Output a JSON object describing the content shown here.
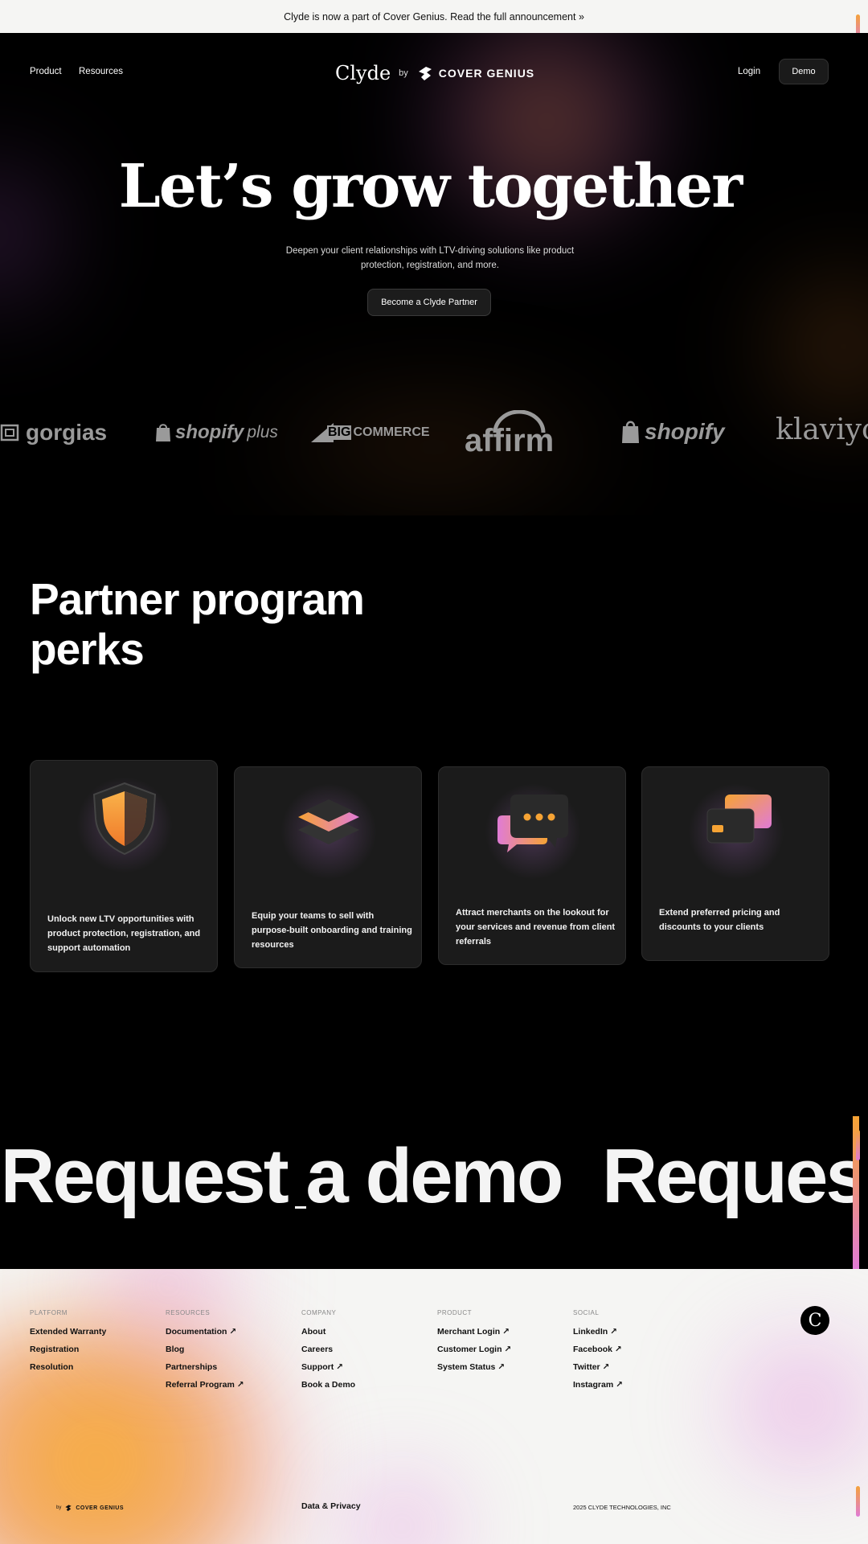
{
  "announcement": {
    "text": "Clyde is now a part of Cover Genius. Read the full announcement »"
  },
  "nav": {
    "links": [
      "Product",
      "Resources"
    ],
    "brand": {
      "clyde": "Clyde",
      "by": "by",
      "partner": "COVER GENIUS"
    },
    "login": "Login",
    "demo": "Demo"
  },
  "hero": {
    "title": "Let’s grow together",
    "subtitle": "Deepen your client relationships with LTV-driving solutions like product protection, registration, and more.",
    "cta": "Become a Clyde Partner"
  },
  "logos": [
    "gorgias",
    "shopify",
    "plus",
    "BIG",
    "COMMERCE",
    "affirm",
    "shopify",
    "klaviyo"
  ],
  "perks": {
    "title_line1": "Partner program",
    "title_line2": "perks",
    "cards": [
      {
        "icon": "shield-icon",
        "text": "Unlock new LTV opportunities with product protection, registration, and support automation"
      },
      {
        "icon": "layers-icon",
        "text": "Equip your teams to sell with purpose-built onboarding and training resources"
      },
      {
        "icon": "chat-bubbles-icon",
        "text": "Attract merchants on the lookout for your services and revenue from client referrals"
      },
      {
        "icon": "credit-cards-icon",
        "text": "Extend preferred pricing and discounts to your clients"
      }
    ]
  },
  "demo_band": {
    "text": "Request a demo",
    "text_repeat": "Reques"
  },
  "footer": {
    "columns": [
      {
        "heading": "PLATFORM",
        "links": [
          "Extended Warranty",
          "Registration",
          "Resolution"
        ]
      },
      {
        "heading": "RESOURCES",
        "links": [
          "Documentation ↗",
          "Blog",
          "Partnerships",
          "Referral Program ↗"
        ]
      },
      {
        "heading": "COMPANY",
        "links": [
          "About",
          "Careers",
          "Support ↗",
          "Book a Demo"
        ]
      },
      {
        "heading": "PRODUCT",
        "links": [
          "Merchant Login ↗",
          "Customer Login ↗",
          "System Status ↗"
        ]
      },
      {
        "heading": "SOCIAL",
        "links": [
          "LinkedIn ↗",
          "Facebook ↗",
          "Twitter ↗",
          "Instagram ↗"
        ]
      }
    ],
    "mark": "C",
    "bottom_brand_by": "by",
    "bottom_brand": "COVER GENIUS",
    "privacy": "Data & Privacy",
    "copyright": "2025 CLYDE TECHNOLOGIES, INC"
  },
  "colors": {
    "accent_orange": "#f6a334",
    "accent_pink": "#e07bd6",
    "bg_dark": "#000000",
    "footer_bg": "#f5f5f3"
  }
}
